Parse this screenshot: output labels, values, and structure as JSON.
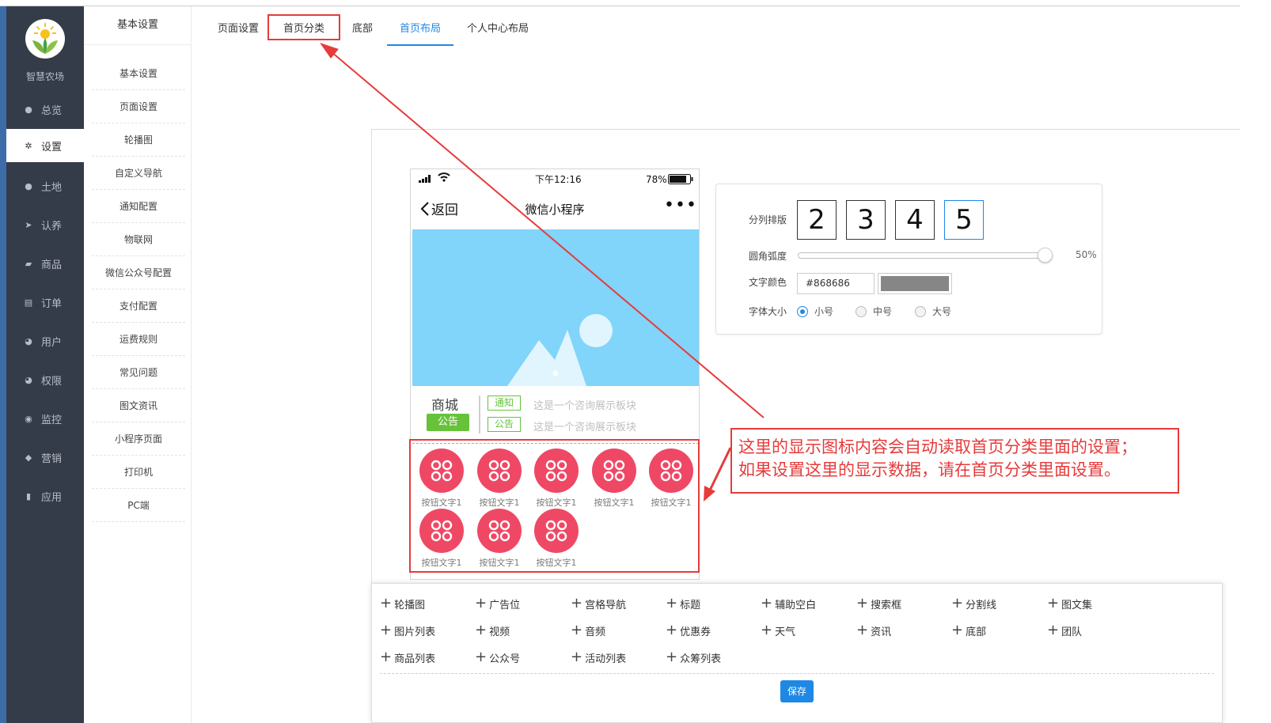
{
  "brand": {
    "name": "智慧农场"
  },
  "sidebar": {
    "items": [
      {
        "label": "总览",
        "icon": "globe-icon"
      },
      {
        "label": "设置",
        "icon": "gear-icon",
        "active": true
      },
      {
        "label": "土地",
        "icon": "globe-icon"
      },
      {
        "label": "认养",
        "icon": "twitter-bird-icon"
      },
      {
        "label": "商品",
        "icon": "cart-icon"
      },
      {
        "label": "订单",
        "icon": "list-icon"
      },
      {
        "label": "用户",
        "icon": "user-icon"
      },
      {
        "label": "权限",
        "icon": "user-icon"
      },
      {
        "label": "监控",
        "icon": "play-circle-icon"
      },
      {
        "label": "营销",
        "icon": "tags-icon"
      },
      {
        "label": "应用",
        "icon": "book-icon"
      }
    ]
  },
  "submenu": {
    "title": "基本设置",
    "items": [
      "基本设置",
      "页面设置",
      "轮播图",
      "自定义导航",
      "通知配置",
      "物联网",
      "微信公众号配置",
      "支付配置",
      "运费规则",
      "常见问题",
      "图文资讯",
      "小程序页面",
      "打印机",
      "PC端"
    ]
  },
  "tabs": {
    "items": [
      "页面设置",
      "首页分类",
      "底部",
      "首页布局",
      "个人中心布局"
    ],
    "active": "首页布局"
  },
  "phone": {
    "status_time": "下午12:16",
    "battery": "78%",
    "back_label": "返回",
    "title": "微信小程序",
    "more": "•••",
    "notice": {
      "title": "商城",
      "badge": "公告",
      "rows": [
        {
          "tag": "通知",
          "text": "这是一个咨询展示板块"
        },
        {
          "tag": "公告",
          "text": "这是一个咨询展示板块"
        }
      ]
    },
    "icon_buttons": [
      "按钮文字1",
      "按钮文字1",
      "按钮文字1",
      "按钮文字1",
      "按钮文字1",
      "按钮文字1",
      "按钮文字1",
      "按钮文字1"
    ]
  },
  "settings": {
    "columns_label": "分列排版",
    "columns": [
      "2",
      "3",
      "4",
      "5"
    ],
    "columns_selected": "5",
    "radius_label": "圆角弧度",
    "radius_value": "50%",
    "radius_fraction": 0.5,
    "color_label": "文字颜色",
    "color_value": "#868686",
    "font_label": "字体大小",
    "font_options": [
      "小号",
      "中号",
      "大号"
    ],
    "font_selected": "小号"
  },
  "callout": {
    "line1": "这里的显示图标内容会自动读取首页分类里面的设置；",
    "line2": "如果设置这里的显示数据，请在首页分类里面设置。"
  },
  "widgets": {
    "items": [
      "轮播图",
      "广告位",
      "宫格导航",
      "标题",
      "辅助空白",
      "搜索框",
      "分割线",
      "图文集",
      "图片列表",
      "视频",
      "音频",
      "优惠券",
      "天气",
      "资讯",
      "底部",
      "团队",
      "商品列表",
      "公众号",
      "活动列表",
      "众筹列表"
    ],
    "save_label": "保存"
  },
  "colors": {
    "sidebar_bg": "#353c49",
    "accent": "#1e88e5",
    "annotation_red": "#e63b3b",
    "icon_red": "#ef4865",
    "banner_blue": "#81d4fa",
    "notice_green": "#67c23a"
  }
}
